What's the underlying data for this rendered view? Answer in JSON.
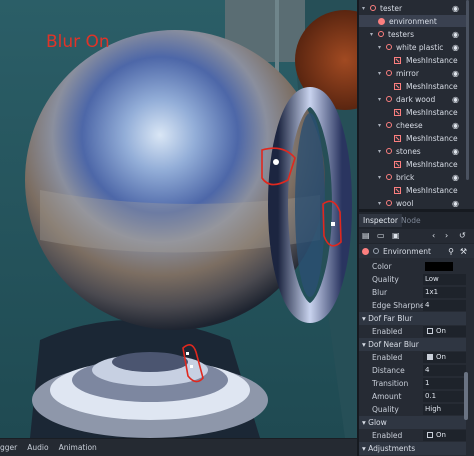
{
  "viewport": {
    "overlay_text": "Blur On"
  },
  "bottom_bar": {
    "items": [
      "gger",
      "Audio",
      "Animation"
    ]
  },
  "scene_tree": {
    "nodes": [
      {
        "label": "tester",
        "depth": 0,
        "kind": "node",
        "expanded": true,
        "icon": "spatial-icon"
      },
      {
        "label": "environment",
        "depth": 1,
        "kind": "env",
        "selected": true,
        "icon": "world-environment-icon"
      },
      {
        "label": "testers",
        "depth": 1,
        "kind": "node",
        "expanded": true,
        "icon": "spatial-icon"
      },
      {
        "label": "white plastic",
        "depth": 2,
        "kind": "node",
        "expanded": true,
        "icon": "spatial-icon"
      },
      {
        "label": "MeshInstance",
        "depth": 3,
        "kind": "mesh",
        "icon": "mesh-instance-icon"
      },
      {
        "label": "mirror",
        "depth": 2,
        "kind": "node",
        "expanded": true,
        "icon": "spatial-icon"
      },
      {
        "label": "MeshInstance",
        "depth": 3,
        "kind": "mesh",
        "icon": "mesh-instance-icon"
      },
      {
        "label": "dark wood",
        "depth": 2,
        "kind": "node",
        "expanded": true,
        "icon": "spatial-icon"
      },
      {
        "label": "MeshInstance",
        "depth": 3,
        "kind": "mesh",
        "icon": "mesh-instance-icon"
      },
      {
        "label": "cheese",
        "depth": 2,
        "kind": "node",
        "expanded": true,
        "icon": "spatial-icon"
      },
      {
        "label": "MeshInstance",
        "depth": 3,
        "kind": "mesh",
        "icon": "mesh-instance-icon"
      },
      {
        "label": "stones",
        "depth": 2,
        "kind": "node",
        "expanded": true,
        "icon": "spatial-icon"
      },
      {
        "label": "MeshInstance",
        "depth": 3,
        "kind": "mesh",
        "icon": "mesh-instance-icon"
      },
      {
        "label": "brick",
        "depth": 2,
        "kind": "node",
        "expanded": true,
        "icon": "spatial-icon"
      },
      {
        "label": "MeshInstance",
        "depth": 3,
        "kind": "mesh",
        "icon": "mesh-instance-icon"
      },
      {
        "label": "wool",
        "depth": 2,
        "kind": "node",
        "expanded": true,
        "icon": "spatial-icon"
      }
    ]
  },
  "inspector": {
    "tabs": [
      "Inspector",
      "Node"
    ],
    "resource_label": "Environment",
    "properties": [
      {
        "type": "prop",
        "label": "Color",
        "swatch": "#000000"
      },
      {
        "type": "prop",
        "label": "Quality",
        "value": "Low"
      },
      {
        "type": "prop",
        "label": "Blur",
        "value": "1x1"
      },
      {
        "type": "prop",
        "label": "Edge Sharpnes",
        "value": "4"
      },
      {
        "type": "section",
        "label": "Dof Far Blur"
      },
      {
        "type": "check",
        "label": "Enabled",
        "value": "On",
        "checked": false
      },
      {
        "type": "section",
        "label": "Dof Near Blur"
      },
      {
        "type": "check",
        "label": "Enabled",
        "value": "On",
        "checked": true
      },
      {
        "type": "prop",
        "label": "Distance",
        "value": "4"
      },
      {
        "type": "prop",
        "label": "Transition",
        "value": "1"
      },
      {
        "type": "prop",
        "label": "Amount",
        "value": "0.1"
      },
      {
        "type": "prop",
        "label": "Quality",
        "value": "High"
      },
      {
        "type": "section",
        "label": "Glow"
      },
      {
        "type": "check",
        "label": "Enabled",
        "value": "On",
        "checked": false
      },
      {
        "type": "section",
        "label": "Adjustments"
      }
    ]
  },
  "colors": {
    "accent": "#fc7f7f",
    "annotation": "#e03328",
    "swatch": "#000000"
  }
}
